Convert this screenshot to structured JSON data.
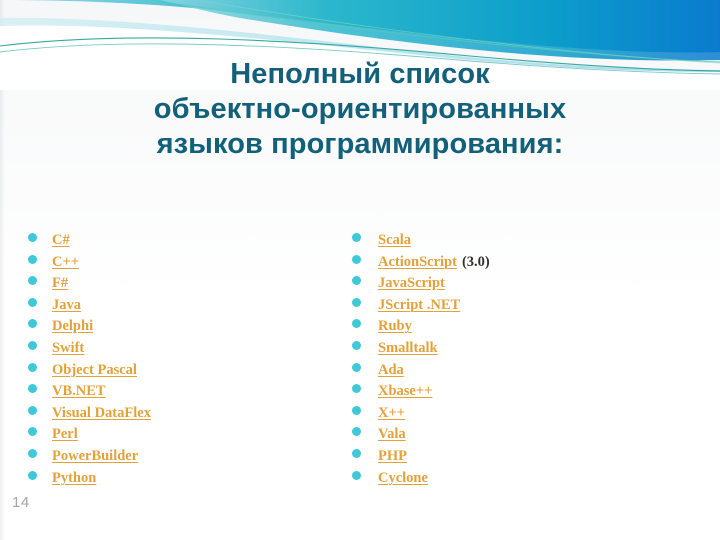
{
  "slide": {
    "page_number": "14",
    "title_lines": [
      "Неполный список",
      "объектно-ориентированных",
      "языков программирования:"
    ],
    "colors": {
      "title": "#12607a",
      "bullet": "#3ec8d8",
      "item_text": "#e3a13a",
      "note_text": "#33322f",
      "page_number": "#a6a6a6",
      "wave_teal": "#12a3b4",
      "wave_blue": "#0b86cf",
      "wave_light": "#a8dfe8",
      "wave_line": "#2aa79b"
    }
  },
  "columns": {
    "left": {
      "items": [
        {
          "label": "C#"
        },
        {
          "label": "C++"
        },
        {
          "label": "F#"
        },
        {
          "label": "Java"
        },
        {
          "label": "Delphi"
        },
        {
          "label": "Swift"
        },
        {
          "label": "Object Pascal"
        },
        {
          "label": "VB.NET"
        },
        {
          "label": "Visual DataFlex"
        },
        {
          "label": "Perl"
        },
        {
          "label": "PowerBuilder"
        },
        {
          "label": "Python"
        }
      ]
    },
    "right": {
      "items": [
        {
          "label": "Scala"
        },
        {
          "label": "ActionScript",
          "note": "(3.0)"
        },
        {
          "label": "JavaScript"
        },
        {
          "label": "JScript .NET"
        },
        {
          "label": "Ruby"
        },
        {
          "label": "Smalltalk"
        },
        {
          "label": "Ada"
        },
        {
          "label": "Xbase++"
        },
        {
          "label": "X++"
        },
        {
          "label": "Vala"
        },
        {
          "label": "PHP"
        },
        {
          "label": "Cyclone"
        }
      ]
    }
  }
}
